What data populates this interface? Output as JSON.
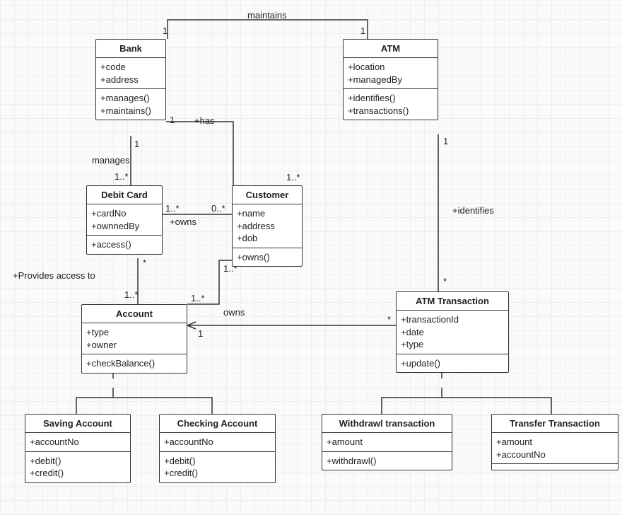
{
  "diagram": {
    "type": "UML Class Diagram",
    "classes": {
      "bank": {
        "name": "Bank",
        "attributes": [
          "+code",
          "+address"
        ],
        "methods": [
          "+manages()",
          "+maintains()"
        ]
      },
      "atm": {
        "name": "ATM",
        "attributes": [
          "+location",
          "+managedBy"
        ],
        "methods": [
          "+identifies()",
          "+transactions()"
        ]
      },
      "debitCard": {
        "name": "Debit Card",
        "attributes": [
          "+cardNo",
          "+ownnedBy"
        ],
        "methods": [
          "+access()"
        ]
      },
      "customer": {
        "name": "Customer",
        "attributes": [
          "+name",
          "+address",
          "+dob"
        ],
        "methods": [
          "+owns()"
        ]
      },
      "account": {
        "name": "Account",
        "attributes": [
          "+type",
          "+owner"
        ],
        "methods": [
          "+checkBalance()"
        ]
      },
      "atmTransaction": {
        "name": "ATM Transaction",
        "attributes": [
          "+transactionId",
          "+date",
          "+type"
        ],
        "methods": [
          "+update()"
        ]
      },
      "savingAccount": {
        "name": "Saving Account",
        "attributes": [
          "+accountNo"
        ],
        "methods": [
          "+debit()",
          "+credit()"
        ]
      },
      "checkingAccount": {
        "name": "Checking Account",
        "attributes": [
          "+accountNo"
        ],
        "methods": [
          "+debit()",
          "+credit()"
        ]
      },
      "withdrawlTransaction": {
        "name": "Withdrawl transaction",
        "attributes": [
          "+amount"
        ],
        "methods": [
          "+withdrawl()"
        ]
      },
      "transferTransaction": {
        "name": "Transfer Transaction",
        "attributes": [
          "+amount",
          "+accountNo"
        ],
        "methods": []
      }
    },
    "relationships": {
      "bank_atm": {
        "label": "maintains",
        "mult_bank": "1",
        "mult_atm": "1"
      },
      "bank_debitCard": {
        "label": "manages",
        "mult_bank": "1",
        "mult_debitCard": "1..*"
      },
      "bank_customer": {
        "label": "+has",
        "mult_bank": "1",
        "mult_customer": "1..*"
      },
      "debitCard_customer": {
        "label": "+owns",
        "mult_debitCard": "1..*",
        "mult_customer": "0..*"
      },
      "debitCard_account": {
        "label": "+Provides access to",
        "mult_debitCard": "*",
        "mult_account": "1..*"
      },
      "customer_account": {
        "label": "owns",
        "mult_customer": "1..*",
        "mult_account": "1..*"
      },
      "atm_atmTransaction": {
        "label": "+identifies",
        "mult_atm": "1",
        "mult_atmTransaction": "*"
      },
      "account_atmTransaction": {
        "label": "",
        "mult_account": "1",
        "mult_atmTransaction": "*"
      },
      "generalizations": [
        {
          "parent": "Account",
          "children": [
            "Saving Account",
            "Checking Account"
          ]
        },
        {
          "parent": "ATM Transaction",
          "children": [
            "Withdrawl transaction",
            "Transfer Transaction"
          ]
        }
      ]
    }
  }
}
